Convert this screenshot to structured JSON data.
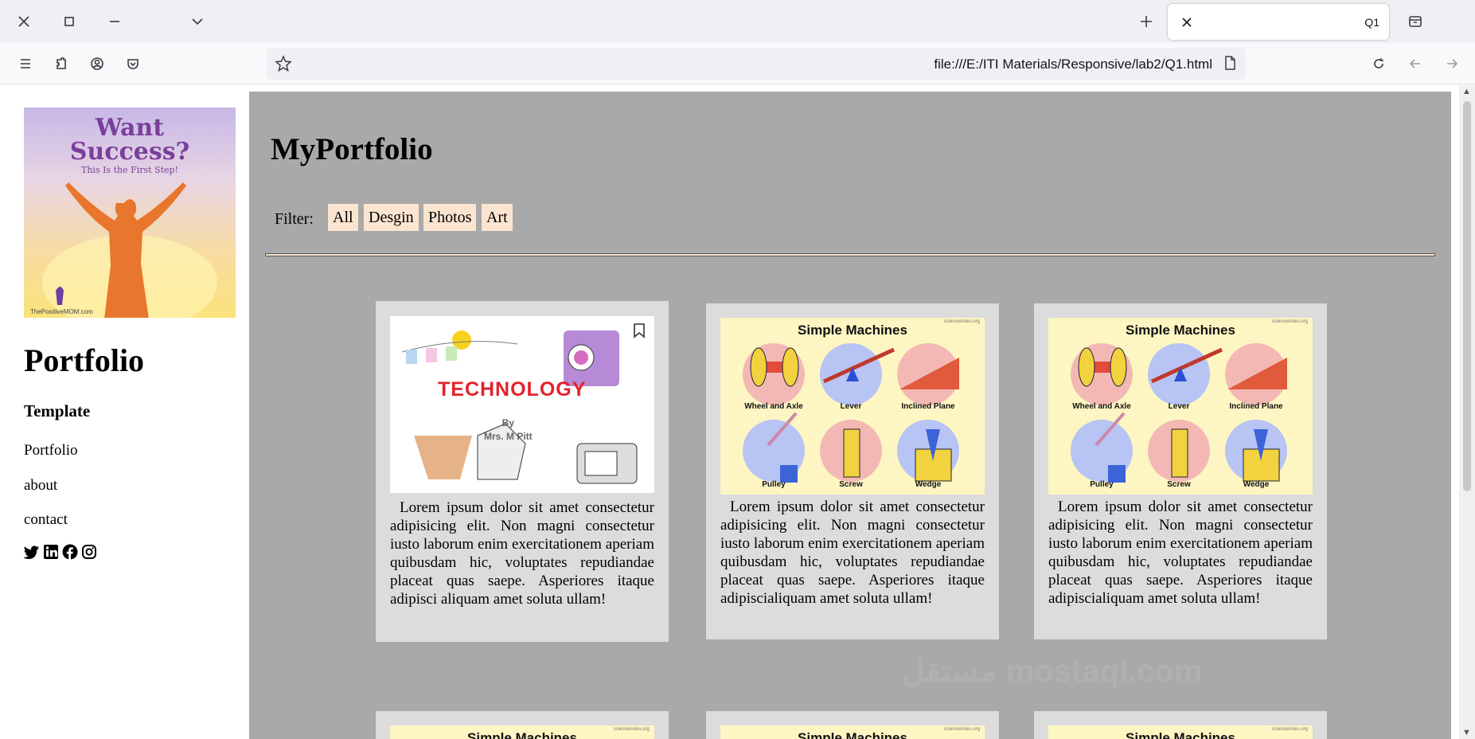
{
  "browser": {
    "tab_title": "Q1",
    "url": "file:///E:/ITI Materials/Responsive/lab2/Q1.html"
  },
  "sidebar": {
    "hero_line1": "Want",
    "hero_line2": "Success?",
    "hero_tagline": "This Is the First Step!",
    "hero_site": "ThePositiveMOM.com",
    "title": "Portfolio",
    "subtitle": "Template",
    "links": [
      "Portfolio",
      "about",
      "contact"
    ],
    "socials": [
      "twitter-icon",
      "linkedin-icon",
      "facebook-icon",
      "instagram-icon"
    ]
  },
  "main": {
    "title": "MyPortfolio",
    "filter_label": "Filter:",
    "filters": [
      "All",
      "Desgin",
      "Photos",
      "Art"
    ],
    "cards": [
      {
        "image_title": "TECHNOLOGY",
        "image_by": "By",
        "image_author": "Mrs. M Pitt",
        "text": "Lorem ipsum dolor sit amet consectetur adipisicing elit. Non magni consectetur iusto laborum enim exercitationem aperiam quibusdam hic, voluptates repudiandae placeat quas saepe. Asperiores itaque adipisci aliquam amet soluta ullam!"
      },
      {
        "image_title": "Simple Machines",
        "text": "Lorem ipsum dolor sit amet consectetur adipisicing elit. Non magni consectetur iusto laborum enim exercitationem aperiam quibusdam hic, voluptates repudiandae placeat quas saepe. Asperiores itaque adipiscialiquam amet soluta ullam!"
      },
      {
        "image_title": "Simple Machines",
        "text": "Lorem ipsum dolor sit amet consectetur adipisicing elit. Non magni consectetur iusto laborum enim exercitationem aperiam quibusdam hic, voluptates repudiandae placeat quas saepe. Asperiores itaque adipiscialiquam amet soluta ullam!"
      }
    ],
    "simple_machines": {
      "site": "sciencenotes.org",
      "labels": [
        "Wheel and Axle",
        "Lever",
        "Inclined Plane",
        "Pulley",
        "Screw",
        "Wedge"
      ]
    }
  },
  "watermark": "مستقل mostaql.com",
  "colors": {
    "main_bg": "#a9a9a9",
    "card_bg": "#dcdcdc",
    "filter_bg": "#fbe4d0"
  }
}
